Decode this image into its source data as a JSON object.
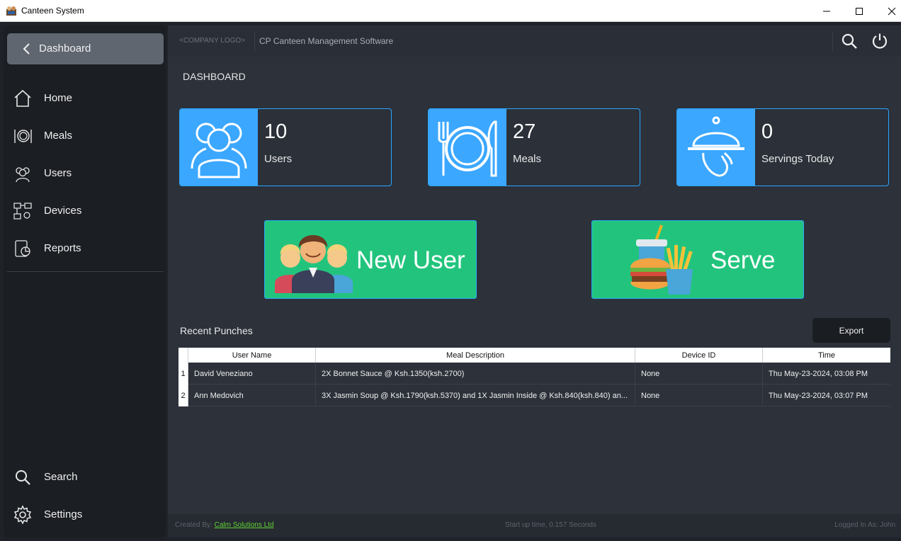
{
  "window": {
    "title": "Canteen System"
  },
  "sidebar": {
    "back_label": "Dashboard",
    "items": [
      {
        "label": "Home",
        "icon": "home-icon"
      },
      {
        "label": "Meals",
        "icon": "meals-icon"
      },
      {
        "label": "Users",
        "icon": "users-icon"
      },
      {
        "label": "Devices",
        "icon": "devices-icon"
      },
      {
        "label": "Reports",
        "icon": "reports-icon"
      }
    ],
    "bottom_items": [
      {
        "label": "Search",
        "icon": "search-icon"
      },
      {
        "label": "Settings",
        "icon": "gear-icon"
      }
    ]
  },
  "header": {
    "logo_placeholder": "<COMPANY LOGO>",
    "app_name": "CP Canteen Management Software"
  },
  "page": {
    "title": "DASHBOARD"
  },
  "cards": [
    {
      "value": "10",
      "label": "Users",
      "icon": "users-group-icon"
    },
    {
      "value": "27",
      "label": "Meals",
      "icon": "plate-cutlery-icon"
    },
    {
      "value": "0",
      "label": "Servings Today",
      "icon": "cloche-serving-icon"
    }
  ],
  "actions": {
    "new_user_label": "New User",
    "serve_label": "Serve"
  },
  "recent": {
    "title": "Recent Punches",
    "export_label": "Export",
    "columns": [
      "User Name",
      "Meal Description",
      "Device ID",
      "Time"
    ],
    "rows": [
      {
        "index": "1",
        "user": "David Veneziano",
        "meal": "2X Bonnet Sauce @ Ksh.1350(ksh.2700)",
        "device": "None",
        "time": "Thu May-23-2024, 03:08 PM"
      },
      {
        "index": "2",
        "user": "Ann Medovich",
        "meal": "3X Jasmin Soup @ Ksh.1790(ksh.5370) and 1X Jasmin Inside @ Ksh.840(ksh.840) an...",
        "device": "None",
        "time": "Thu May-23-2024, 03:07 PM"
      }
    ]
  },
  "footer": {
    "created_by_label": "Created By: ",
    "company_link": "Calm Solutions Ltd",
    "startup_text": "Start up time, 0.157 Seconds",
    "logged_in_text": "Logged In As: John"
  },
  "colors": {
    "accent_blue": "#3ba7ff",
    "action_green": "#22c47d",
    "link_green": "#5fd433"
  }
}
